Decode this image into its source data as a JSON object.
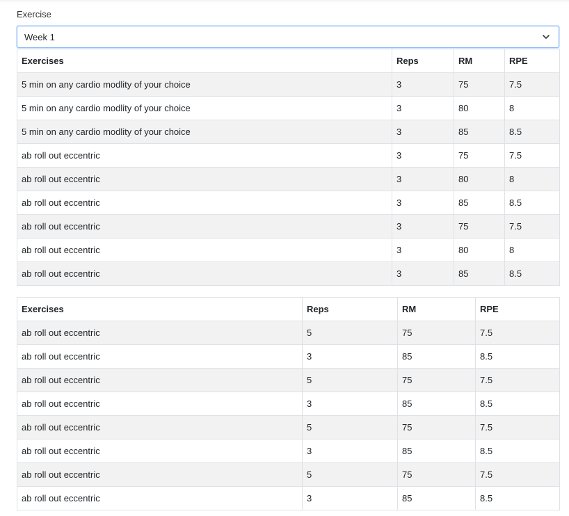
{
  "form": {
    "label": "Exercise",
    "select_value": "Week 1"
  },
  "table1": {
    "headers": [
      "Exercises",
      "Reps",
      "RM",
      "RPE"
    ],
    "rows": [
      [
        "5 min on any cardio modlity of your choice",
        "3",
        "75",
        "7.5"
      ],
      [
        "5 min on any cardio modlity of your choice",
        "3",
        "80",
        "8"
      ],
      [
        "5 min on any cardio modlity of your choice",
        "3",
        "85",
        "8.5"
      ],
      [
        "ab roll out eccentric",
        "3",
        "75",
        "7.5"
      ],
      [
        "ab roll out eccentric",
        "3",
        "80",
        "8"
      ],
      [
        "ab roll out eccentric",
        "3",
        "85",
        "8.5"
      ],
      [
        "ab roll out eccentric",
        "3",
        "75",
        "7.5"
      ],
      [
        "ab roll out eccentric",
        "3",
        "80",
        "8"
      ],
      [
        "ab roll out eccentric",
        "3",
        "85",
        "8.5"
      ]
    ]
  },
  "table2": {
    "headers": [
      "Exercises",
      "Reps",
      "RM",
      "RPE"
    ],
    "rows": [
      [
        "ab roll out eccentric",
        "5",
        "75",
        "7.5"
      ],
      [
        "ab roll out eccentric",
        "3",
        "85",
        "8.5"
      ],
      [
        "ab roll out eccentric",
        "5",
        "75",
        "7.5"
      ],
      [
        "ab roll out eccentric",
        "3",
        "85",
        "8.5"
      ],
      [
        "ab roll out eccentric",
        "5",
        "75",
        "7.5"
      ],
      [
        "ab roll out eccentric",
        "3",
        "85",
        "8.5"
      ],
      [
        "ab roll out eccentric",
        "5",
        "75",
        "7.5"
      ],
      [
        "ab roll out eccentric",
        "3",
        "85",
        "8.5"
      ]
    ]
  }
}
